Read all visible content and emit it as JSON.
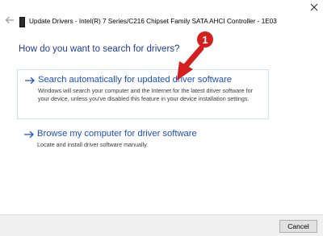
{
  "window": {
    "title": "Update Drivers - Intel(R) 7 Series/C216 Chipset Family SATA AHCI Controller - 1E03",
    "back_icon": "back-arrow-icon",
    "close_icon": "close-icon",
    "device_icon": "device-icon"
  },
  "main": {
    "heading": "How do you want to search for drivers?",
    "options": [
      {
        "title": "Search automatically for updated driver software",
        "description": "Windows will search your computer and the Internet for the latest driver software for your device, unless you've disabled this feature in your device installation settings.",
        "icon": "right-arrow-icon",
        "selected": true
      },
      {
        "title": "Browse my computer for driver software",
        "description": "Locate and install driver software manually.",
        "icon": "right-arrow-icon",
        "selected": false
      }
    ]
  },
  "annotation": {
    "step_number": "1",
    "color": "#d41f1f"
  },
  "footer": {
    "cancel_label": "Cancel"
  },
  "colors": {
    "link_blue": "#1c4fbf",
    "heading_blue": "#1f3a93",
    "selection_border": "#cfe3f7"
  }
}
